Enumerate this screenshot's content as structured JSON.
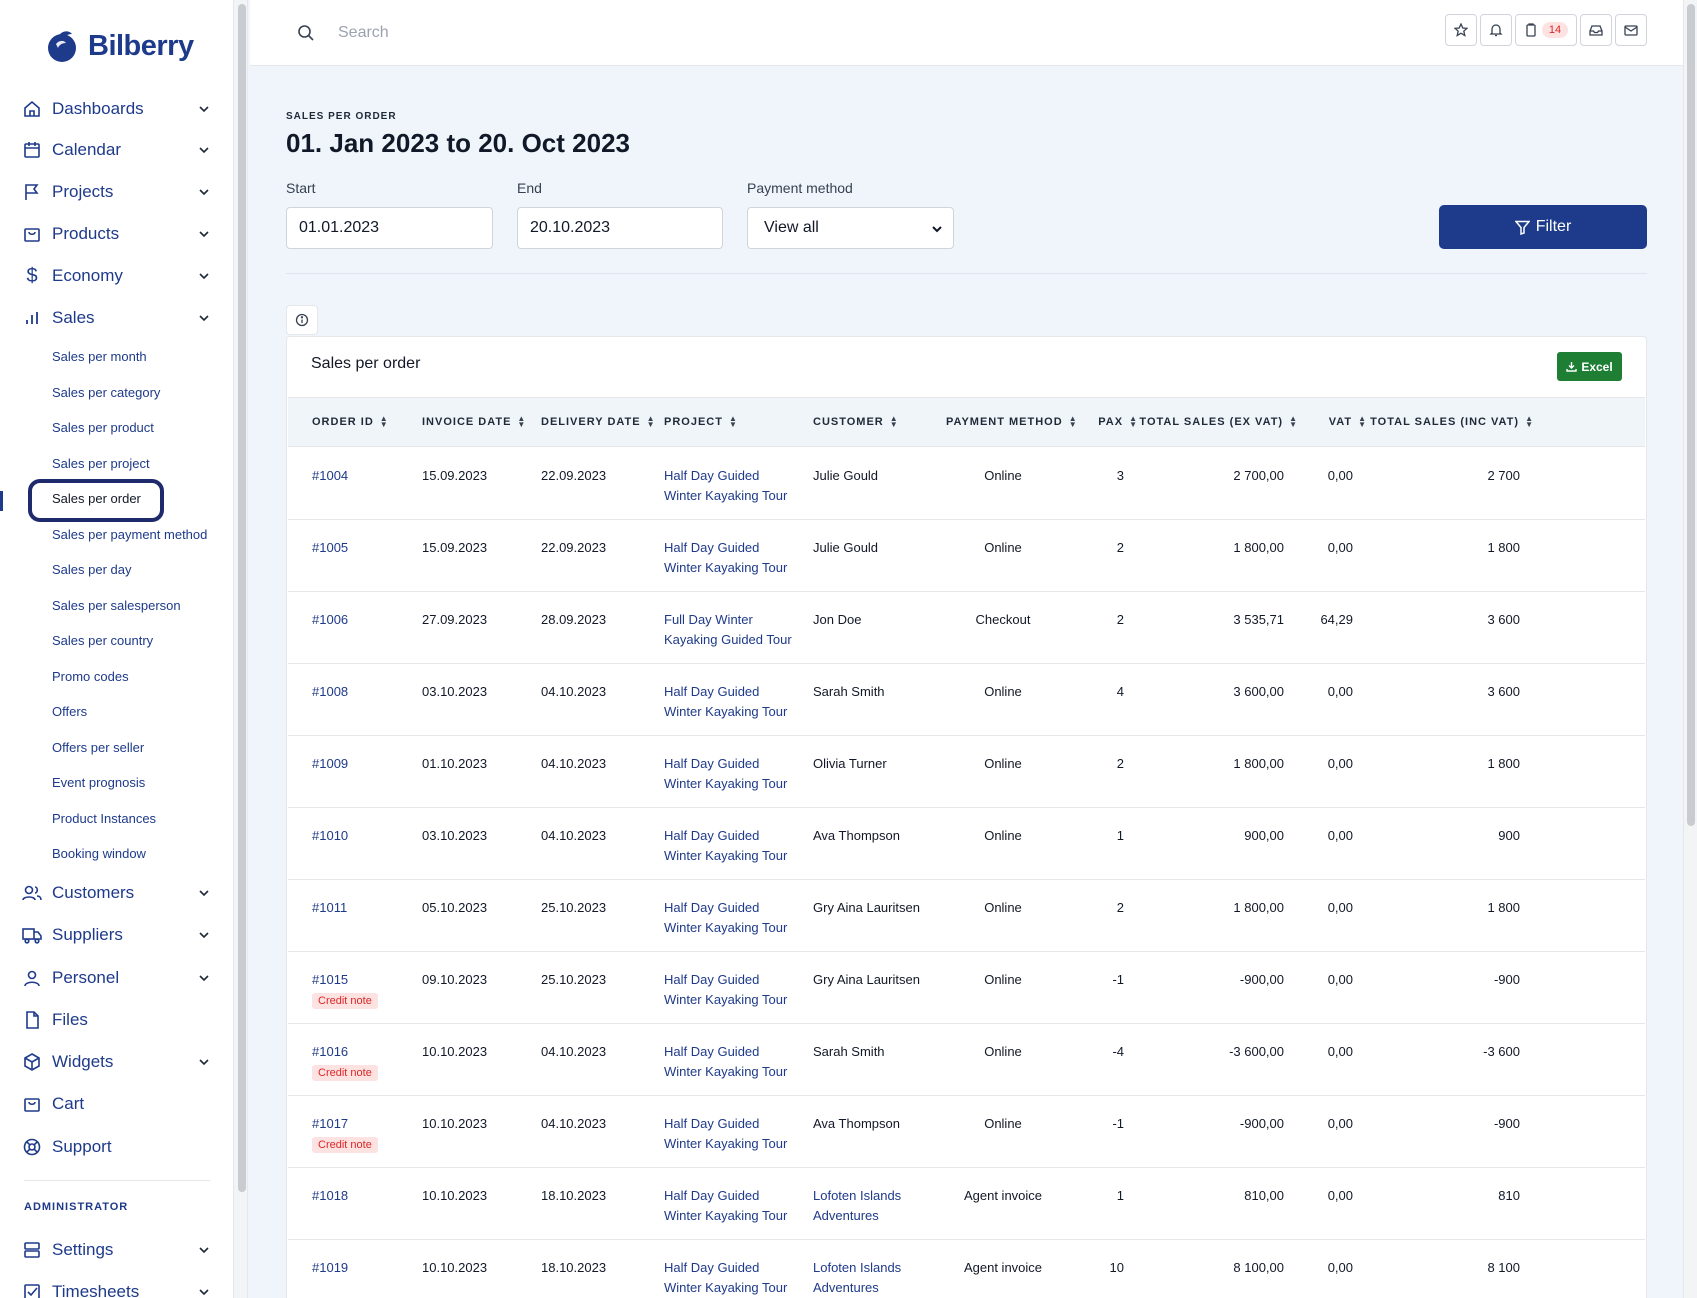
{
  "app": {
    "logo_text": "Bilberry"
  },
  "search": {
    "placeholder": "Search"
  },
  "header": {
    "badge_count": "14"
  },
  "sidebar": {
    "main_items": [
      {
        "label": "Dashboards"
      },
      {
        "label": "Calendar"
      },
      {
        "label": "Projects"
      },
      {
        "label": "Products"
      },
      {
        "label": "Economy"
      },
      {
        "label": "Sales"
      }
    ],
    "sales_sub": [
      "Sales per month",
      "Sales per category",
      "Sales per product",
      "Sales per project",
      "Sales per order",
      "Sales per payment method",
      "Sales per day",
      "Sales per salesperson",
      "Sales per country",
      "Promo codes",
      "Offers",
      "Offers per seller",
      "Event prognosis",
      "Product Instances",
      "Booking window"
    ],
    "lower_items": [
      {
        "label": "Customers"
      },
      {
        "label": "Suppliers"
      },
      {
        "label": "Personel"
      },
      {
        "label": "Files"
      },
      {
        "label": "Widgets"
      },
      {
        "label": "Cart"
      },
      {
        "label": "Support"
      }
    ],
    "admin_label": "ADMINISTRATOR",
    "admin_items": [
      {
        "label": "Settings"
      },
      {
        "label": "Timesheets"
      }
    ]
  },
  "page": {
    "eyebrow": "SALES PER ORDER",
    "title": "01. Jan 2023 to 20. Oct 2023"
  },
  "filters": {
    "start_label": "Start",
    "start_value": "01.01.2023",
    "end_label": "End",
    "end_value": "20.10.2023",
    "payment_label": "Payment method",
    "payment_value": "View all",
    "filter_button": "Filter"
  },
  "card": {
    "title": "Sales per order",
    "excel_button": "Excel"
  },
  "table": {
    "columns": [
      "ORDER ID",
      "INVOICE DATE",
      "DELIVERY DATE",
      "PROJECT",
      "CUSTOMER",
      "PAYMENT METHOD",
      "PAX",
      "TOTAL SALES (EX VAT)",
      "VAT",
      "TOTAL SALES (INC VAT)"
    ],
    "credit_label": "Credit note",
    "rows": [
      {
        "id": "#1004",
        "invoice": "15.09.2023",
        "delivery": "22.09.2023",
        "project": "Half Day Guided Winter Kayaking Tour",
        "customer": "Julie Gould",
        "customer_link": false,
        "payment": "Online",
        "pax": "3",
        "ex_vat": "2 700,00",
        "vat": "0,00",
        "inc_vat": "2 700",
        "credit": false
      },
      {
        "id": "#1005",
        "invoice": "15.09.2023",
        "delivery": "22.09.2023",
        "project": "Half Day Guided Winter Kayaking Tour",
        "customer": "Julie Gould",
        "customer_link": false,
        "payment": "Online",
        "pax": "2",
        "ex_vat": "1 800,00",
        "vat": "0,00",
        "inc_vat": "1 800",
        "credit": false
      },
      {
        "id": "#1006",
        "invoice": "27.09.2023",
        "delivery": "28.09.2023",
        "project": "Full Day Winter Kayaking Guided Tour",
        "customer": "Jon Doe",
        "customer_link": false,
        "payment": "Checkout",
        "pax": "2",
        "ex_vat": "3 535,71",
        "vat": "64,29",
        "inc_vat": "3 600",
        "credit": false
      },
      {
        "id": "#1008",
        "invoice": "03.10.2023",
        "delivery": "04.10.2023",
        "project": "Half Day Guided Winter Kayaking Tour",
        "customer": "Sarah Smith",
        "customer_link": false,
        "payment": "Online",
        "pax": "4",
        "ex_vat": "3 600,00",
        "vat": "0,00",
        "inc_vat": "3 600",
        "credit": false
      },
      {
        "id": "#1009",
        "invoice": "01.10.2023",
        "delivery": "04.10.2023",
        "project": "Half Day Guided Winter Kayaking Tour",
        "customer": "Olivia Turner",
        "customer_link": false,
        "payment": "Online",
        "pax": "2",
        "ex_vat": "1 800,00",
        "vat": "0,00",
        "inc_vat": "1 800",
        "credit": false
      },
      {
        "id": "#1010",
        "invoice": "03.10.2023",
        "delivery": "04.10.2023",
        "project": "Half Day Guided Winter Kayaking Tour",
        "customer": "Ava Thompson",
        "customer_link": false,
        "payment": "Online",
        "pax": "1",
        "ex_vat": "900,00",
        "vat": "0,00",
        "inc_vat": "900",
        "credit": false
      },
      {
        "id": "#1011",
        "invoice": "05.10.2023",
        "delivery": "25.10.2023",
        "project": "Half Day Guided Winter Kayaking Tour",
        "customer": "Gry Aina Lauritsen",
        "customer_link": false,
        "payment": "Online",
        "pax": "2",
        "ex_vat": "1 800,00",
        "vat": "0,00",
        "inc_vat": "1 800",
        "credit": false
      },
      {
        "id": "#1015",
        "invoice": "09.10.2023",
        "delivery": "25.10.2023",
        "project": "Half Day Guided Winter Kayaking Tour",
        "customer": "Gry Aina Lauritsen",
        "customer_link": false,
        "payment": "Online",
        "pax": "-1",
        "ex_vat": "-900,00",
        "vat": "0,00",
        "inc_vat": "-900",
        "credit": true
      },
      {
        "id": "#1016",
        "invoice": "10.10.2023",
        "delivery": "04.10.2023",
        "project": "Half Day Guided Winter Kayaking Tour",
        "customer": "Sarah Smith",
        "customer_link": false,
        "payment": "Online",
        "pax": "-4",
        "ex_vat": "-3 600,00",
        "vat": "0,00",
        "inc_vat": "-3 600",
        "credit": true
      },
      {
        "id": "#1017",
        "invoice": "10.10.2023",
        "delivery": "04.10.2023",
        "project": "Half Day Guided Winter Kayaking Tour",
        "customer": "Ava Thompson",
        "customer_link": false,
        "payment": "Online",
        "pax": "-1",
        "ex_vat": "-900,00",
        "vat": "0,00",
        "inc_vat": "-900",
        "credit": true
      },
      {
        "id": "#1018",
        "invoice": "10.10.2023",
        "delivery": "18.10.2023",
        "project": "Half Day Guided Winter Kayaking Tour",
        "customer": "Lofoten Islands Adventures",
        "customer_link": true,
        "payment": "Agent invoice",
        "pax": "1",
        "ex_vat": "810,00",
        "vat": "0,00",
        "inc_vat": "810",
        "credit": false
      },
      {
        "id": "#1019",
        "invoice": "10.10.2023",
        "delivery": "18.10.2023",
        "project": "Half Day Guided Winter Kayaking Tour",
        "customer": "Lofoten Islands Adventures",
        "customer_link": true,
        "payment": "Agent invoice",
        "pax": "10",
        "ex_vat": "8 100,00",
        "vat": "0,00",
        "inc_vat": "8 100",
        "credit": false
      }
    ]
  },
  "colors": {
    "brand": "#1e3a8a",
    "excel": "#1e7e34",
    "credit": "#dc2626"
  }
}
